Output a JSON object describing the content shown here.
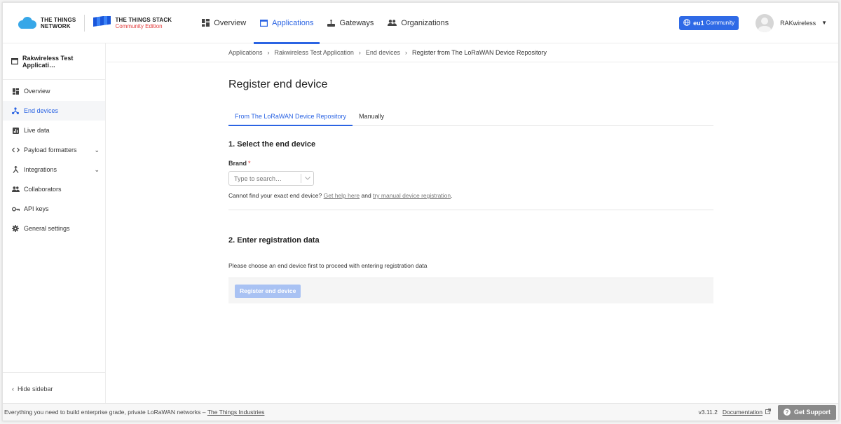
{
  "header": {
    "logo_ttn_line1": "THE THINGS",
    "logo_ttn_line2": "NETWORK",
    "logo_stack_title": "THE THINGS STACK",
    "logo_stack_subtitle": "Community Edition",
    "nav": [
      {
        "label": "Overview",
        "icon": "grid-icon"
      },
      {
        "label": "Applications",
        "icon": "applications-icon",
        "active": true
      },
      {
        "label": "Gateways",
        "icon": "gateway-icon"
      },
      {
        "label": "Organizations",
        "icon": "organizations-icon"
      }
    ],
    "cluster_region": "eu1",
    "cluster_label": "Community",
    "user_name": "RAKwireless"
  },
  "sidebar": {
    "app_name": "Rakwireless Test Applicati…",
    "items": [
      {
        "label": "Overview",
        "icon": "dashboard-icon"
      },
      {
        "label": "End devices",
        "icon": "device-hub-icon",
        "active": true
      },
      {
        "label": "Live data",
        "icon": "live-data-icon"
      },
      {
        "label": "Payload formatters",
        "icon": "code-icon",
        "expandable": true
      },
      {
        "label": "Integrations",
        "icon": "integrations-icon",
        "expandable": true
      },
      {
        "label": "Collaborators",
        "icon": "people-icon"
      },
      {
        "label": "API keys",
        "icon": "key-icon"
      },
      {
        "label": "General settings",
        "icon": "gear-icon"
      }
    ],
    "hide_label": "Hide sidebar"
  },
  "breadcrumb": [
    "Applications",
    "Rakwireless Test Application",
    "End devices",
    "Register from The LoRaWAN Device Repository"
  ],
  "main": {
    "title": "Register end device",
    "tabs": [
      {
        "label": "From The LoRaWAN Device Repository",
        "active": true
      },
      {
        "label": "Manually"
      }
    ],
    "section1_title": "1. Select the end device",
    "brand_label": "Brand",
    "brand_required": "*",
    "brand_placeholder": "Type to search…",
    "help_prefix": "Cannot find your exact end device?",
    "help_link1": "Get help here",
    "help_and": "and",
    "help_link2": "try manual device registration",
    "help_suffix": ".",
    "section2_title": "2. Enter registration data",
    "section2_info": "Please choose an end device first to proceed with entering registration data",
    "register_button": "Register end device"
  },
  "footer": {
    "tagline": "Everything you need to build enterprise grade, private LoRaWAN networks –",
    "tagline_link": "The Things Industries",
    "version": "v3.11.2",
    "documentation": "Documentation",
    "support": "Get Support"
  },
  "colors": {
    "accent": "#2b64e3",
    "badge": "#2f6ae6",
    "required": "#e23b3b",
    "disabled_button": "#a9c2f3",
    "support_button": "#8a8a8a"
  }
}
